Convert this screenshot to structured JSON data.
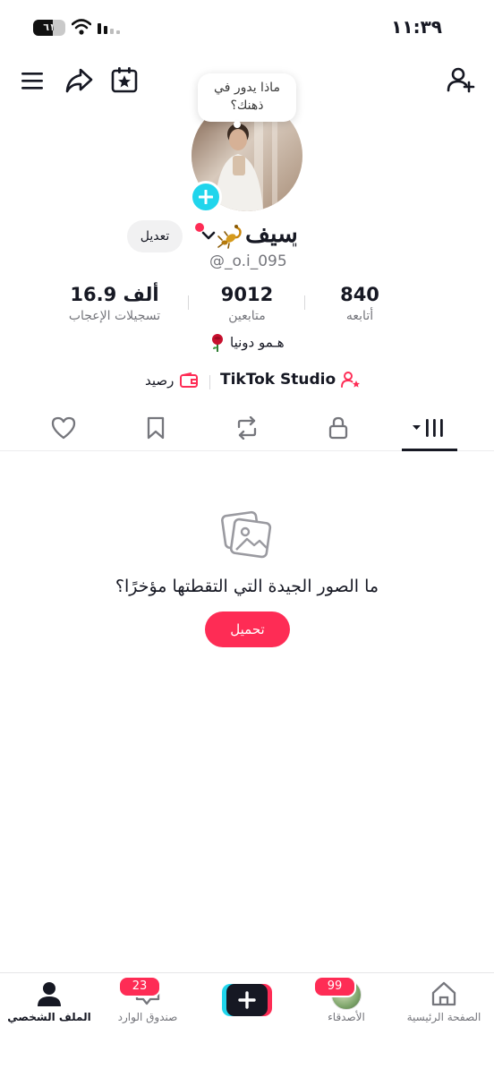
{
  "status_bar": {
    "time": "١١:٣٩",
    "battery": "٦١",
    "battery_level_percent": 61
  },
  "bubble": {
    "line1": "ماذا يدور في",
    "line2": "ذهنك؟"
  },
  "profile": {
    "display_name": "سيف",
    "name_mark": "\"",
    "username": "@_o.i_095",
    "edit_label": "تعديل",
    "bio": "هـمو دونيا"
  },
  "stats": {
    "following": {
      "value": "840",
      "label": "أتابعه"
    },
    "followers": {
      "value": "9012",
      "label": "متابعين"
    },
    "likes": {
      "value": "16.9 ألف",
      "label": "تسجيلات الإعجاب"
    }
  },
  "links": {
    "studio": "TikTok Studio",
    "balance": "رصيد"
  },
  "tabs": [
    "videos-grid",
    "private-lock",
    "reposts",
    "favorites-bookmark",
    "liked-heart"
  ],
  "empty_state": {
    "message": "ما الصور الجيدة التي التقطتها مؤخرًا؟",
    "upload_label": "تحميل"
  },
  "bottom_nav": {
    "home": "الصفحة الرئيسية",
    "friends": "الأصدقاء",
    "friends_badge": "99",
    "inbox": "صندوق الوارد",
    "inbox_badge": "23",
    "profile": "الملف الشخصي"
  },
  "colors": {
    "accent": "#fe2c55",
    "cyan": "#20d5ec",
    "text": "#161823",
    "muted": "#75767c"
  }
}
